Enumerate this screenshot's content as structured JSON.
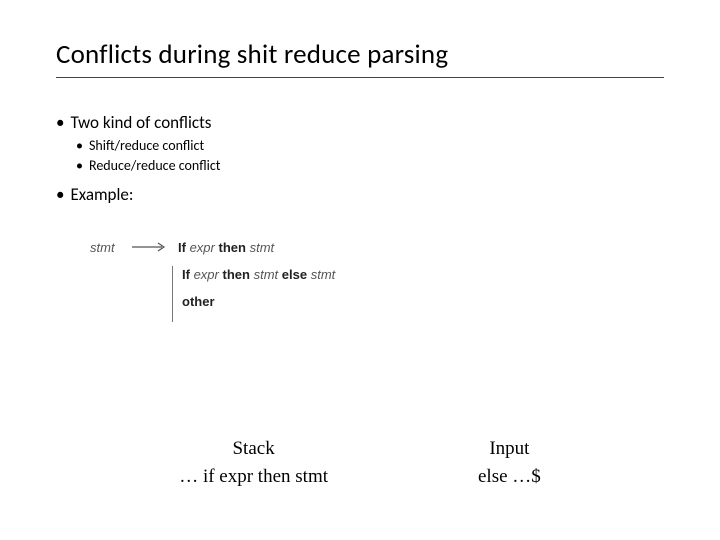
{
  "title": "Conflicts during shit reduce parsing",
  "bullets": {
    "b1a": "Two kind of conflicts",
    "b2a": "Shift/reduce conflict",
    "b2b": "Reduce/reduce conflict",
    "b1b": "Example:"
  },
  "grammar": {
    "lhs": "stmt",
    "rhs1_kw1": "If",
    "rhs1_it1": "expr",
    "rhs1_kw2": "then",
    "rhs1_it2": "stmt",
    "rhs2_kw1": "If",
    "rhs2_it1": "expr",
    "rhs2_kw2": "then",
    "rhs2_it2": "stmt",
    "rhs2_kw3": "else",
    "rhs2_it3": "stmt",
    "rhs3_kw1": "other"
  },
  "table": {
    "stack_header": "Stack",
    "stack_value": "… if expr then stmt",
    "input_header": "Input",
    "input_value": "else …$"
  }
}
